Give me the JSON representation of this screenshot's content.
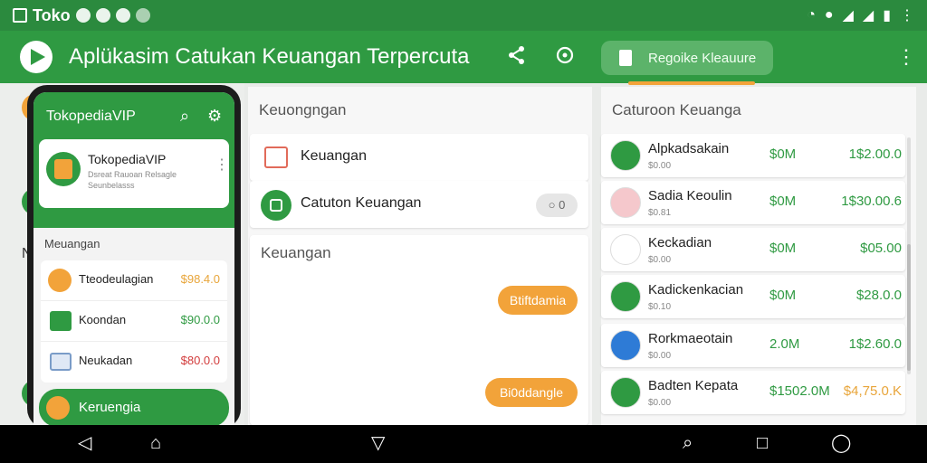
{
  "statusbar": {
    "app": "Toko",
    "icons": [
      "image-icon",
      "alarm-icon",
      "location-icon",
      "wifi-icon",
      "signal-icon",
      "battery-icon",
      "more-icon"
    ]
  },
  "appbar": {
    "title": "Aplükasim Catukan Keuangan Terpercuta",
    "pill_label": "Regoike Kleauure",
    "colors": {
      "brand": "#2f9a42",
      "accent": "#f2a33a"
    }
  },
  "middle": {
    "header": "Keuongngan",
    "items": [
      {
        "label": "Keuangan"
      },
      {
        "label": "Catuton Keuangan",
        "badge": "○ 0"
      }
    ],
    "section_title": "Keuangan",
    "button1": "Btiftdamia",
    "button2": "Bi0ddangle"
  },
  "right": {
    "header": "Caturoon Keuanga",
    "rows": [
      {
        "name": "Alpkadsakain",
        "sub": "$0.00",
        "amount": "$0M",
        "total": "1$2.00.0",
        "icon_color": "#2f9a42",
        "amount_color": "#2f9a42",
        "total_color": "#2f9a42"
      },
      {
        "name": "Sadia Keoulin",
        "sub": "$0.81",
        "amount": "$0M",
        "total": "1$30.00.6",
        "icon_color": "#f5c8cc",
        "amount_color": "#2f9a42",
        "total_color": "#2f9a42"
      },
      {
        "name": "Keckadian",
        "sub": "$0.00",
        "amount": "$0M",
        "total": "$05.00",
        "icon_color": "#ffffff",
        "amount_color": "#2f9a42",
        "total_color": "#2f9a42"
      },
      {
        "name": "Kadickenkacian",
        "sub": "$0.10",
        "amount": "$0M",
        "total": "$28.0.0",
        "icon_color": "#2f9a42",
        "amount_color": "#2f9a42",
        "total_color": "#2f9a42"
      },
      {
        "name": "Rorkmaeotain",
        "sub": "$0.00",
        "amount": "2.0M",
        "total": "1$2.60.0",
        "icon_color": "#2e7bd6",
        "amount_color": "#2f9a42",
        "total_color": "#2f9a42"
      },
      {
        "name": "Badten Kepata",
        "sub": "$0.00",
        "amount": "$1502.0M",
        "total": "$4,75.0.K",
        "icon_color": "#2f9a42",
        "amount_color": "#2f9a42",
        "total_color": "#e8a53a"
      }
    ]
  },
  "phone": {
    "title": "TokopediaVIP",
    "profile_name": "TokopediaVIP",
    "profile_line1": "Dsreat Rauoan Relsagle",
    "profile_line2": "Seunbelasss",
    "section": "Meuangan",
    "items": [
      {
        "name": "Tteodeulagian",
        "value": "$98.4.0",
        "color": "#e8a53a"
      },
      {
        "name": "Koondan",
        "value": "$90.0.0",
        "color": "#2f9a42"
      },
      {
        "name": "Neukadan",
        "value": "$80.0.0",
        "color": "#d23b3b"
      }
    ],
    "bottom": "Keruengia"
  },
  "bg": {
    "left_text": "N"
  }
}
